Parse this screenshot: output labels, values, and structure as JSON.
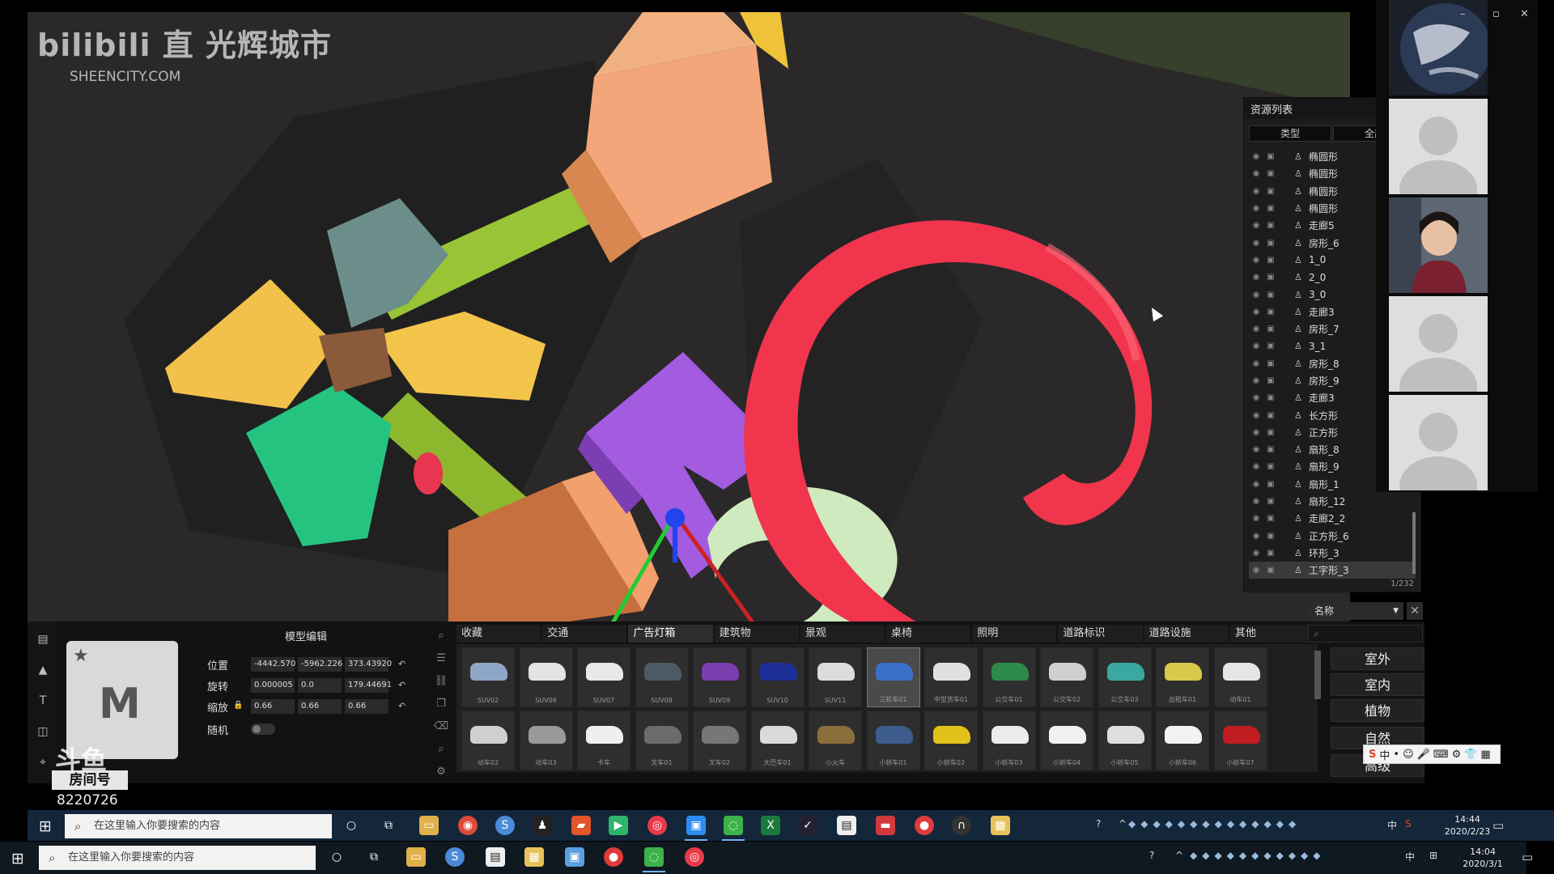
{
  "watermark": {
    "title": "bilibili 直 光辉城市",
    "subtitle": "SHEENCITY.COM"
  },
  "resource_panel": {
    "title": "资源列表",
    "filters": [
      "类型",
      "全部"
    ],
    "items": [
      "椭圆形",
      "椭圆形",
      "椭圆形",
      "椭圆形",
      "走廊5",
      "房形_6",
      "1_0",
      "2_0",
      "3_0",
      "走廊3",
      "房形_7",
      "3_1",
      "房形_8",
      "房形_9",
      "走廊3",
      "长方形",
      "正方形",
      "扇形_8",
      "扇形_9",
      "扇形_1",
      "扇形_12",
      "走廊2_2",
      "正方形_6",
      "环形_3",
      "工字形_3"
    ],
    "selected_index": 24,
    "count": "1/232"
  },
  "window_controls": [
    "–",
    "▫",
    "✕"
  ],
  "model_editor": {
    "title": "模型编辑",
    "position_label": "位置",
    "position": [
      "-4442.570",
      "-5962.226",
      "373.43920"
    ],
    "rotation_label": "旋转",
    "rotation": [
      "0.000005",
      "0.0",
      "179.44691"
    ],
    "scale_label": "缩放",
    "scale": [
      "0.66",
      "0.66",
      "0.66"
    ],
    "random_label": "随机"
  },
  "room": {
    "label": "房间号",
    "number": "8220726",
    "logo_text": "斗鱼"
  },
  "category_tabs": [
    "收藏",
    "交通",
    "广告灯箱",
    "建筑物",
    "景观",
    "桌椅",
    "照明",
    "道路标识",
    "道路设施",
    "其他"
  ],
  "active_tab": 2,
  "assets": [
    {
      "label": "SUV02",
      "color": "#8fa7c7"
    },
    {
      "label": "SUV06",
      "color": "#e4e4e4"
    },
    {
      "label": "SUV07",
      "color": "#e8e8e8"
    },
    {
      "label": "SUV08",
      "color": "#4e5a63"
    },
    {
      "label": "SUV09",
      "color": "#7b3fb0"
    },
    {
      "label": "SUV10",
      "color": "#1f2f99"
    },
    {
      "label": "SUV11",
      "color": "#dcdcdc"
    },
    {
      "label": "三轮车01",
      "color": "#3b6fc7"
    },
    {
      "label": "中型货车01",
      "color": "#e0e0e0"
    },
    {
      "label": "公交车01",
      "color": "#2e8a4b"
    },
    {
      "label": "公交车02",
      "color": "#cfcfcf"
    },
    {
      "label": "公交车03",
      "color": "#3aa8a1"
    },
    {
      "label": "出租车01",
      "color": "#d9c84a"
    },
    {
      "label": "动车01",
      "color": "#e6e6e6"
    },
    {
      "label": "动车02",
      "color": "#d0d0d0"
    },
    {
      "label": "动车03",
      "color": "#9a9a9a"
    },
    {
      "label": "卡车",
      "color": "#efefef"
    },
    {
      "label": "叉车01",
      "color": "#6b6b6b"
    },
    {
      "label": "叉车02",
      "color": "#777777"
    },
    {
      "label": "大巴车01",
      "color": "#dadada"
    },
    {
      "label": "小火车",
      "color": "#8a6f3a"
    },
    {
      "label": "小轿车01",
      "color": "#3d5d8f"
    },
    {
      "label": "小轿车02",
      "color": "#e2c21a"
    },
    {
      "label": "小轿车03",
      "color": "#ececec"
    },
    {
      "label": "小轿车04",
      "color": "#f0f0f0"
    },
    {
      "label": "小轿车05",
      "color": "#dedede"
    },
    {
      "label": "小轿车06",
      "color": "#f2f2f2"
    },
    {
      "label": "小轿车07",
      "color": "#c01c22"
    }
  ],
  "selected_asset": 7,
  "name_dropdown": "名称",
  "side_buttons": [
    "室外",
    "室内",
    "植物",
    "自然",
    "高级"
  ],
  "ime_icons": [
    "S",
    "中",
    "•",
    "☺",
    "🎤",
    "⌨",
    "⚙",
    "👕",
    "▦"
  ],
  "taskbar_top": {
    "search_placeholder": "在这里输入你要搜索的内容",
    "time": "14:44",
    "date": "2020/2/23",
    "tray": [
      "?",
      "^",
      "中",
      "S"
    ]
  },
  "taskbar_bottom": {
    "search_placeholder": "在这里输入你要搜索的内容",
    "time": "14:04",
    "date": "2020/3/1",
    "tray": [
      "?",
      "^",
      "中",
      "⊞"
    ]
  }
}
